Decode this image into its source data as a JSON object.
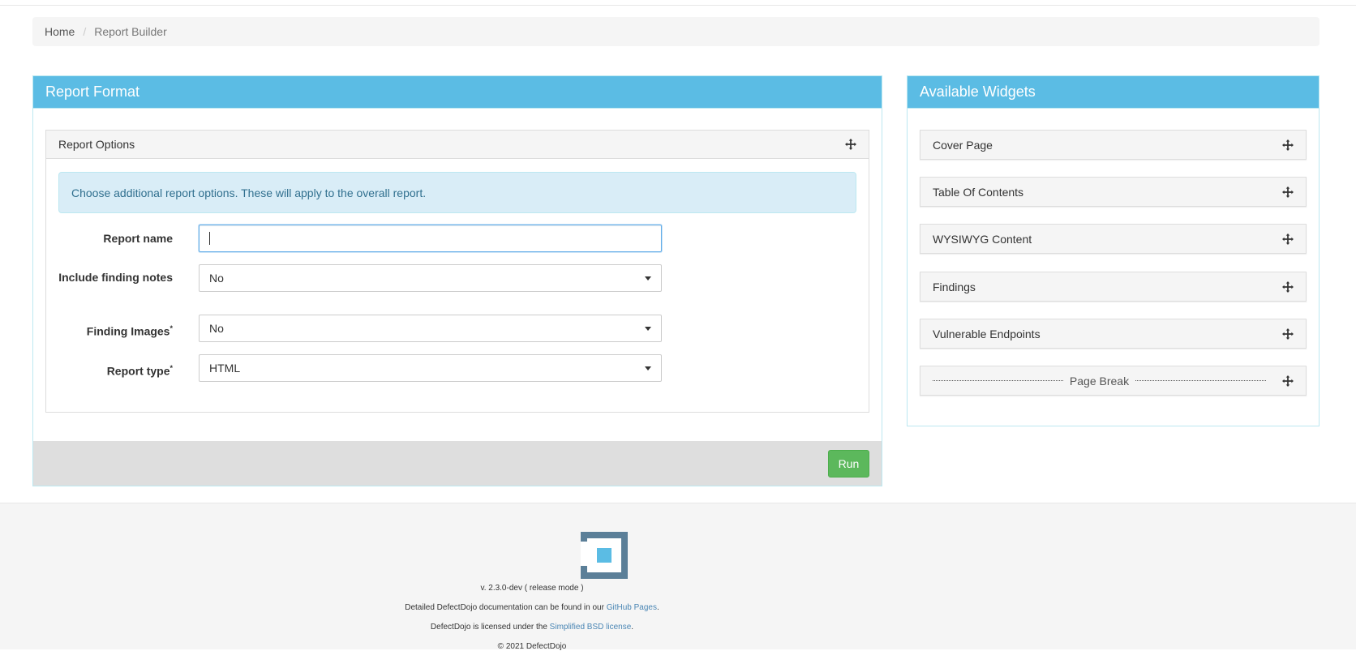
{
  "breadcrumb": {
    "home": "Home",
    "separator": "/",
    "current": "Report Builder"
  },
  "report_format": {
    "title": "Report Format",
    "options_panel": {
      "title": "Report Options",
      "info": "Choose additional report options. These will apply to the overall report.",
      "fields": {
        "report_name": {
          "label": "Report name",
          "value": ""
        },
        "finding_notes": {
          "label": "Include finding notes",
          "value": "No"
        },
        "finding_images": {
          "label": "Finding Images",
          "required": "*",
          "value": "No"
        },
        "report_type": {
          "label": "Report type",
          "required": "*",
          "value": "HTML"
        }
      }
    },
    "run_label": "Run"
  },
  "widgets": {
    "title": "Available Widgets",
    "items": [
      "Cover Page",
      "Table Of Contents",
      "WYSIWYG Content",
      "Findings",
      "Vulnerable Endpoints"
    ],
    "page_break": "Page Break"
  },
  "footer": {
    "version": "v. 2.3.0-dev ( release mode )",
    "docs_prefix": "Detailed DefectDojo documentation can be found in our ",
    "docs_link": "GitHub Pages",
    "docs_suffix": ".",
    "license_prefix": "DefectDojo is licensed under the ",
    "license_link": "Simplified BSD license",
    "license_suffix": ".",
    "copyright": "© 2021 DefectDojo"
  },
  "icons": {
    "move": "arrows-move-icon",
    "logo": "defectdojo-logo"
  },
  "colors": {
    "panel_heading": "#5bbce4",
    "run_button": "#5cb85c",
    "info_bg": "#d9edf7",
    "link": "#4a86b4"
  }
}
